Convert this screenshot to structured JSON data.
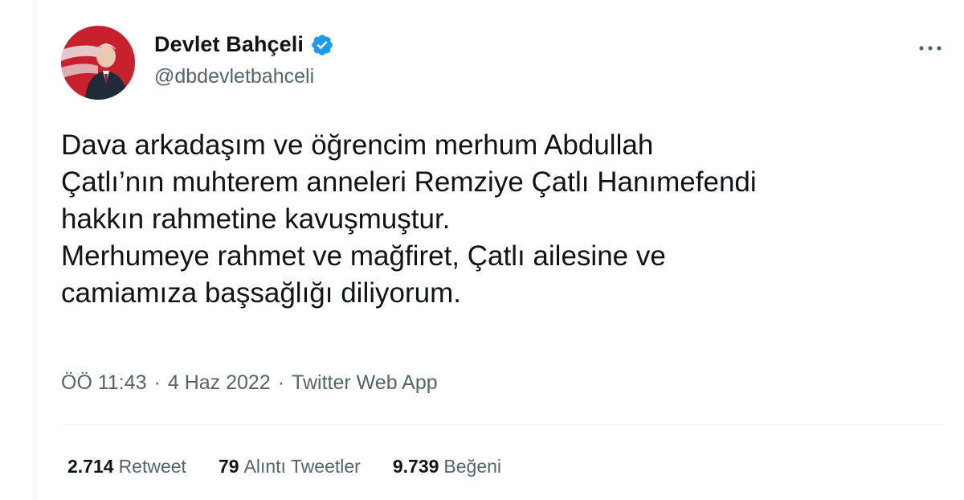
{
  "author": {
    "display_name": "Devlet Bahçeli",
    "handle": "@dbdevletbahceli",
    "verified": true
  },
  "tweet": {
    "text": "Dava arkadaşım ve öğrencim merhum Abdullah\nÇatlı’nın muhterem anneleri Remziye Çatlı Hanımefendi\nhakkın rahmetine kavuşmuştur.\nMerhumeye rahmet ve mağfiret, Çatlı ailesine ve\ncamiamıza başsağlığı diliyorum.",
    "time": "ÖÖ 11:43",
    "date": "4 Haz 2022",
    "source": "Twitter Web App",
    "separator": "·"
  },
  "stats": [
    {
      "count": "2.714",
      "label": "Retweet"
    },
    {
      "count": "79",
      "label": "Alıntı Tweetler"
    },
    {
      "count": "9.739",
      "label": "Beğeni"
    }
  ],
  "icons": {
    "verified": "verified-badge-icon",
    "more": "more-horizontal-icon"
  },
  "colors": {
    "text_primary": "#0f1419",
    "text_secondary": "#536471",
    "verified_blue": "#1d9bf0",
    "divider": "#eff3f4"
  }
}
